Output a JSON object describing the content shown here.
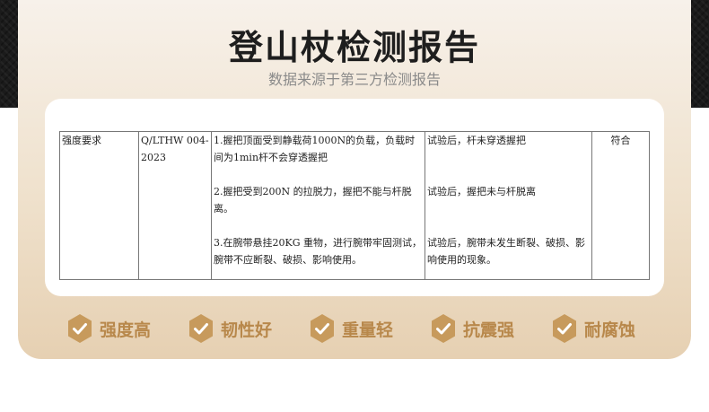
{
  "header": {
    "title": "登山杖检测报告",
    "subtitle": "数据来源于第三方检测报告"
  },
  "report": {
    "requirement": "强度要求",
    "standard": "Q/LTHW 004-2023",
    "tests": [
      {
        "method": "1.握把顶面受到静载荷1000N的负载，负载时间为1min杆不会穿透握把",
        "result": "试验后，杆未穿透握把"
      },
      {
        "method": "2.握把受到200N 的拉脱力，握把不能与杆脱离。",
        "result": "试验后，握把未与杆脱离"
      },
      {
        "method": "3.在腕带悬挂20KG 重物，进行腕带牢固测试，腕带不应断裂、破损、影响使用。",
        "result": "试验后，腕带未发生断裂、破损、影响使用的现象。"
      }
    ],
    "verdict": "符合"
  },
  "features": [
    {
      "label": "强度高",
      "icon": "check-hexagon-icon"
    },
    {
      "label": "韧性好",
      "icon": "check-hexagon-icon"
    },
    {
      "label": "重量轻",
      "icon": "check-hexagon-icon"
    },
    {
      "label": "抗震强",
      "icon": "check-hexagon-icon"
    },
    {
      "label": "耐腐蚀",
      "icon": "check-hexagon-icon"
    }
  ],
  "colors": {
    "accent": "#b8884b",
    "badge": "#c79a5c"
  }
}
